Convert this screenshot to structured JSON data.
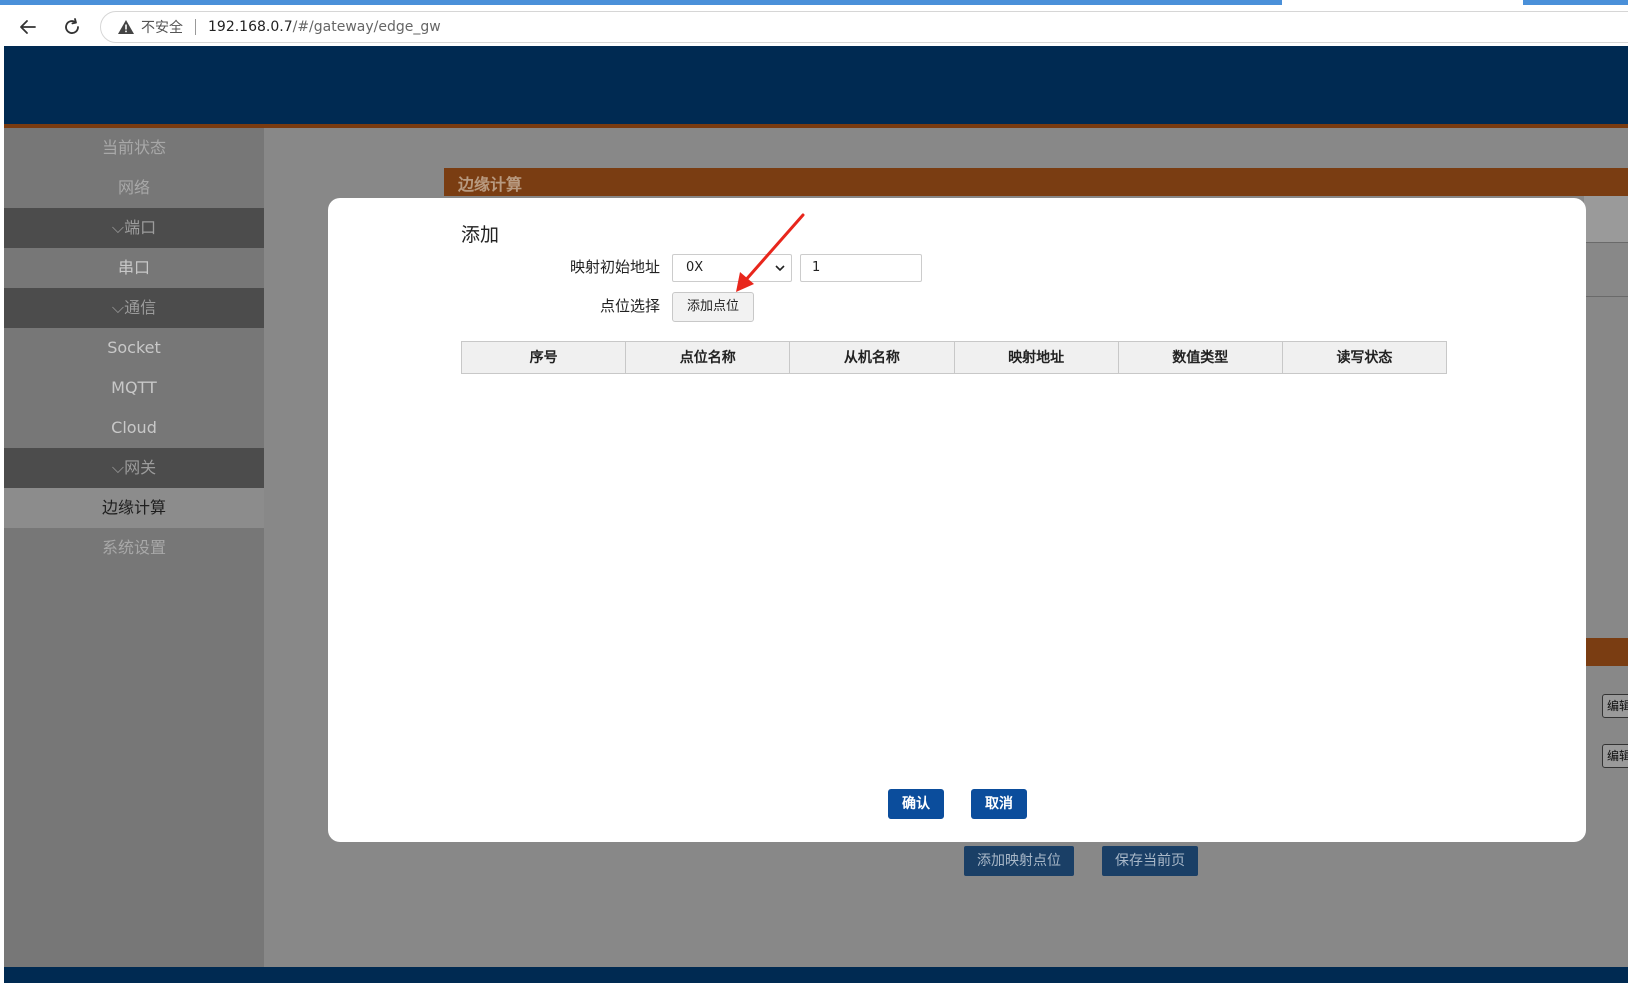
{
  "browser": {
    "security_label": "不安全",
    "url_host": "192.168.0.7",
    "url_path": "/#/gateway/edge_gw"
  },
  "sidebar": {
    "items": [
      {
        "label": "当前状态",
        "kind": "item"
      },
      {
        "label": "网络",
        "kind": "item"
      },
      {
        "label": "端口",
        "kind": "group"
      },
      {
        "label": "串口",
        "kind": "item"
      },
      {
        "label": "通信",
        "kind": "group"
      },
      {
        "label": "Socket",
        "kind": "item"
      },
      {
        "label": "MQTT",
        "kind": "item"
      },
      {
        "label": "Cloud",
        "kind": "item"
      },
      {
        "label": "网关",
        "kind": "group"
      },
      {
        "label": "边缘计算",
        "kind": "active"
      },
      {
        "label": "系统设置",
        "kind": "item"
      }
    ]
  },
  "background": {
    "section_title": "边缘计算",
    "edit_label": "编辑",
    "add_mapping_button": "添加映射点位",
    "save_page_button": "保存当前页"
  },
  "modal": {
    "title": "添加",
    "map_start_label": "映射初始地址",
    "prefix_value": "0X",
    "address_value": "1",
    "point_select_label": "点位选择",
    "add_point_button": "添加点位",
    "table_headers": [
      "序号",
      "点位名称",
      "从机名称",
      "映射地址",
      "数值类型",
      "读写状态"
    ],
    "confirm_button": "确认",
    "cancel_button": "取消"
  },
  "colors": {
    "header": "#002a52",
    "accent_band": "#7a3d12",
    "primary_button": "#0b4d9c",
    "annotation_arrow": "#e8261c"
  }
}
